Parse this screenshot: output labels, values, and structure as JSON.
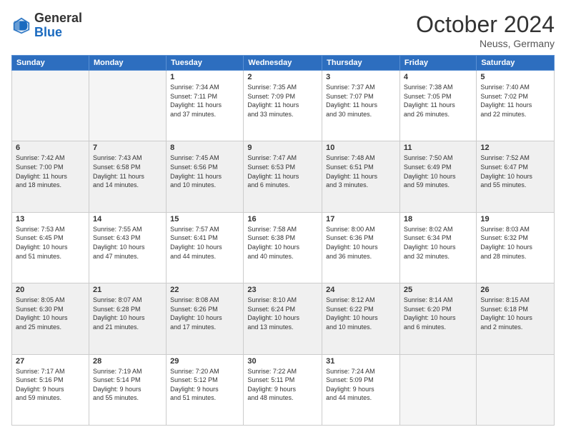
{
  "header": {
    "logo_general": "General",
    "logo_blue": "Blue",
    "month_year": "October 2024",
    "location": "Neuss, Germany"
  },
  "weekdays": [
    "Sunday",
    "Monday",
    "Tuesday",
    "Wednesday",
    "Thursday",
    "Friday",
    "Saturday"
  ],
  "weeks": [
    [
      {
        "day": "",
        "info": ""
      },
      {
        "day": "",
        "info": ""
      },
      {
        "day": "1",
        "info": "Sunrise: 7:34 AM\nSunset: 7:11 PM\nDaylight: 11 hours\nand 37 minutes."
      },
      {
        "day": "2",
        "info": "Sunrise: 7:35 AM\nSunset: 7:09 PM\nDaylight: 11 hours\nand 33 minutes."
      },
      {
        "day": "3",
        "info": "Sunrise: 7:37 AM\nSunset: 7:07 PM\nDaylight: 11 hours\nand 30 minutes."
      },
      {
        "day": "4",
        "info": "Sunrise: 7:38 AM\nSunset: 7:05 PM\nDaylight: 11 hours\nand 26 minutes."
      },
      {
        "day": "5",
        "info": "Sunrise: 7:40 AM\nSunset: 7:02 PM\nDaylight: 11 hours\nand 22 minutes."
      }
    ],
    [
      {
        "day": "6",
        "info": "Sunrise: 7:42 AM\nSunset: 7:00 PM\nDaylight: 11 hours\nand 18 minutes."
      },
      {
        "day": "7",
        "info": "Sunrise: 7:43 AM\nSunset: 6:58 PM\nDaylight: 11 hours\nand 14 minutes."
      },
      {
        "day": "8",
        "info": "Sunrise: 7:45 AM\nSunset: 6:56 PM\nDaylight: 11 hours\nand 10 minutes."
      },
      {
        "day": "9",
        "info": "Sunrise: 7:47 AM\nSunset: 6:53 PM\nDaylight: 11 hours\nand 6 minutes."
      },
      {
        "day": "10",
        "info": "Sunrise: 7:48 AM\nSunset: 6:51 PM\nDaylight: 11 hours\nand 3 minutes."
      },
      {
        "day": "11",
        "info": "Sunrise: 7:50 AM\nSunset: 6:49 PM\nDaylight: 10 hours\nand 59 minutes."
      },
      {
        "day": "12",
        "info": "Sunrise: 7:52 AM\nSunset: 6:47 PM\nDaylight: 10 hours\nand 55 minutes."
      }
    ],
    [
      {
        "day": "13",
        "info": "Sunrise: 7:53 AM\nSunset: 6:45 PM\nDaylight: 10 hours\nand 51 minutes."
      },
      {
        "day": "14",
        "info": "Sunrise: 7:55 AM\nSunset: 6:43 PM\nDaylight: 10 hours\nand 47 minutes."
      },
      {
        "day": "15",
        "info": "Sunrise: 7:57 AM\nSunset: 6:41 PM\nDaylight: 10 hours\nand 44 minutes."
      },
      {
        "day": "16",
        "info": "Sunrise: 7:58 AM\nSunset: 6:38 PM\nDaylight: 10 hours\nand 40 minutes."
      },
      {
        "day": "17",
        "info": "Sunrise: 8:00 AM\nSunset: 6:36 PM\nDaylight: 10 hours\nand 36 minutes."
      },
      {
        "day": "18",
        "info": "Sunrise: 8:02 AM\nSunset: 6:34 PM\nDaylight: 10 hours\nand 32 minutes."
      },
      {
        "day": "19",
        "info": "Sunrise: 8:03 AM\nSunset: 6:32 PM\nDaylight: 10 hours\nand 28 minutes."
      }
    ],
    [
      {
        "day": "20",
        "info": "Sunrise: 8:05 AM\nSunset: 6:30 PM\nDaylight: 10 hours\nand 25 minutes."
      },
      {
        "day": "21",
        "info": "Sunrise: 8:07 AM\nSunset: 6:28 PM\nDaylight: 10 hours\nand 21 minutes."
      },
      {
        "day": "22",
        "info": "Sunrise: 8:08 AM\nSunset: 6:26 PM\nDaylight: 10 hours\nand 17 minutes."
      },
      {
        "day": "23",
        "info": "Sunrise: 8:10 AM\nSunset: 6:24 PM\nDaylight: 10 hours\nand 13 minutes."
      },
      {
        "day": "24",
        "info": "Sunrise: 8:12 AM\nSunset: 6:22 PM\nDaylight: 10 hours\nand 10 minutes."
      },
      {
        "day": "25",
        "info": "Sunrise: 8:14 AM\nSunset: 6:20 PM\nDaylight: 10 hours\nand 6 minutes."
      },
      {
        "day": "26",
        "info": "Sunrise: 8:15 AM\nSunset: 6:18 PM\nDaylight: 10 hours\nand 2 minutes."
      }
    ],
    [
      {
        "day": "27",
        "info": "Sunrise: 7:17 AM\nSunset: 5:16 PM\nDaylight: 9 hours\nand 59 minutes."
      },
      {
        "day": "28",
        "info": "Sunrise: 7:19 AM\nSunset: 5:14 PM\nDaylight: 9 hours\nand 55 minutes."
      },
      {
        "day": "29",
        "info": "Sunrise: 7:20 AM\nSunset: 5:12 PM\nDaylight: 9 hours\nand 51 minutes."
      },
      {
        "day": "30",
        "info": "Sunrise: 7:22 AM\nSunset: 5:11 PM\nDaylight: 9 hours\nand 48 minutes."
      },
      {
        "day": "31",
        "info": "Sunrise: 7:24 AM\nSunset: 5:09 PM\nDaylight: 9 hours\nand 44 minutes."
      },
      {
        "day": "",
        "info": ""
      },
      {
        "day": "",
        "info": ""
      }
    ]
  ]
}
